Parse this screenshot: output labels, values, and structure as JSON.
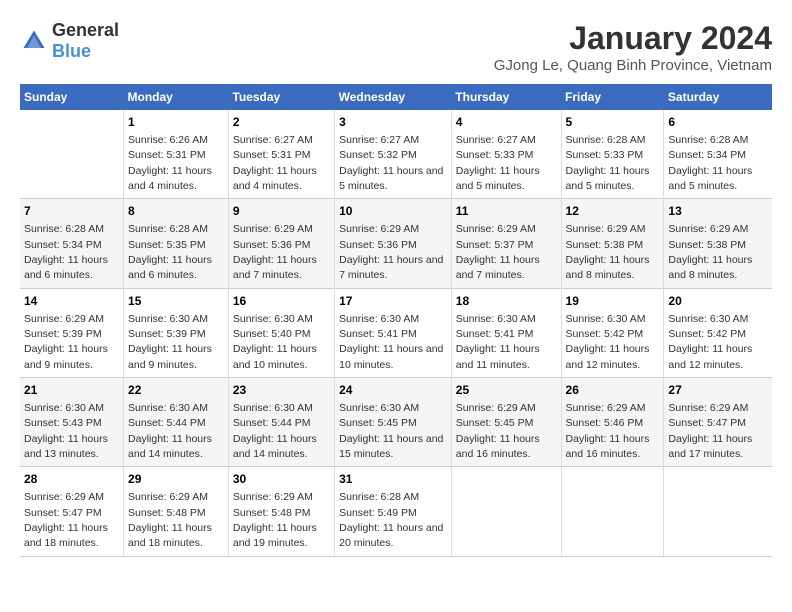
{
  "header": {
    "logo_general": "General",
    "logo_blue": "Blue",
    "title": "January 2024",
    "subtitle": "GJong Le, Quang Binh Province, Vietnam"
  },
  "days_of_week": [
    "Sunday",
    "Monday",
    "Tuesday",
    "Wednesday",
    "Thursday",
    "Friday",
    "Saturday"
  ],
  "weeks": [
    [
      {
        "day": "",
        "sunrise": "",
        "sunset": "",
        "daylight": ""
      },
      {
        "day": "1",
        "sunrise": "Sunrise: 6:26 AM",
        "sunset": "Sunset: 5:31 PM",
        "daylight": "Daylight: 11 hours and 4 minutes."
      },
      {
        "day": "2",
        "sunrise": "Sunrise: 6:27 AM",
        "sunset": "Sunset: 5:31 PM",
        "daylight": "Daylight: 11 hours and 4 minutes."
      },
      {
        "day": "3",
        "sunrise": "Sunrise: 6:27 AM",
        "sunset": "Sunset: 5:32 PM",
        "daylight": "Daylight: 11 hours and 5 minutes."
      },
      {
        "day": "4",
        "sunrise": "Sunrise: 6:27 AM",
        "sunset": "Sunset: 5:33 PM",
        "daylight": "Daylight: 11 hours and 5 minutes."
      },
      {
        "day": "5",
        "sunrise": "Sunrise: 6:28 AM",
        "sunset": "Sunset: 5:33 PM",
        "daylight": "Daylight: 11 hours and 5 minutes."
      },
      {
        "day": "6",
        "sunrise": "Sunrise: 6:28 AM",
        "sunset": "Sunset: 5:34 PM",
        "daylight": "Daylight: 11 hours and 5 minutes."
      }
    ],
    [
      {
        "day": "7",
        "sunrise": "Sunrise: 6:28 AM",
        "sunset": "Sunset: 5:34 PM",
        "daylight": "Daylight: 11 hours and 6 minutes."
      },
      {
        "day": "8",
        "sunrise": "Sunrise: 6:28 AM",
        "sunset": "Sunset: 5:35 PM",
        "daylight": "Daylight: 11 hours and 6 minutes."
      },
      {
        "day": "9",
        "sunrise": "Sunrise: 6:29 AM",
        "sunset": "Sunset: 5:36 PM",
        "daylight": "Daylight: 11 hours and 7 minutes."
      },
      {
        "day": "10",
        "sunrise": "Sunrise: 6:29 AM",
        "sunset": "Sunset: 5:36 PM",
        "daylight": "Daylight: 11 hours and 7 minutes."
      },
      {
        "day": "11",
        "sunrise": "Sunrise: 6:29 AM",
        "sunset": "Sunset: 5:37 PM",
        "daylight": "Daylight: 11 hours and 7 minutes."
      },
      {
        "day": "12",
        "sunrise": "Sunrise: 6:29 AM",
        "sunset": "Sunset: 5:38 PM",
        "daylight": "Daylight: 11 hours and 8 minutes."
      },
      {
        "day": "13",
        "sunrise": "Sunrise: 6:29 AM",
        "sunset": "Sunset: 5:38 PM",
        "daylight": "Daylight: 11 hours and 8 minutes."
      }
    ],
    [
      {
        "day": "14",
        "sunrise": "Sunrise: 6:29 AM",
        "sunset": "Sunset: 5:39 PM",
        "daylight": "Daylight: 11 hours and 9 minutes."
      },
      {
        "day": "15",
        "sunrise": "Sunrise: 6:30 AM",
        "sunset": "Sunset: 5:39 PM",
        "daylight": "Daylight: 11 hours and 9 minutes."
      },
      {
        "day": "16",
        "sunrise": "Sunrise: 6:30 AM",
        "sunset": "Sunset: 5:40 PM",
        "daylight": "Daylight: 11 hours and 10 minutes."
      },
      {
        "day": "17",
        "sunrise": "Sunrise: 6:30 AM",
        "sunset": "Sunset: 5:41 PM",
        "daylight": "Daylight: 11 hours and 10 minutes."
      },
      {
        "day": "18",
        "sunrise": "Sunrise: 6:30 AM",
        "sunset": "Sunset: 5:41 PM",
        "daylight": "Daylight: 11 hours and 11 minutes."
      },
      {
        "day": "19",
        "sunrise": "Sunrise: 6:30 AM",
        "sunset": "Sunset: 5:42 PM",
        "daylight": "Daylight: 11 hours and 12 minutes."
      },
      {
        "day": "20",
        "sunrise": "Sunrise: 6:30 AM",
        "sunset": "Sunset: 5:42 PM",
        "daylight": "Daylight: 11 hours and 12 minutes."
      }
    ],
    [
      {
        "day": "21",
        "sunrise": "Sunrise: 6:30 AM",
        "sunset": "Sunset: 5:43 PM",
        "daylight": "Daylight: 11 hours and 13 minutes."
      },
      {
        "day": "22",
        "sunrise": "Sunrise: 6:30 AM",
        "sunset": "Sunset: 5:44 PM",
        "daylight": "Daylight: 11 hours and 14 minutes."
      },
      {
        "day": "23",
        "sunrise": "Sunrise: 6:30 AM",
        "sunset": "Sunset: 5:44 PM",
        "daylight": "Daylight: 11 hours and 14 minutes."
      },
      {
        "day": "24",
        "sunrise": "Sunrise: 6:30 AM",
        "sunset": "Sunset: 5:45 PM",
        "daylight": "Daylight: 11 hours and 15 minutes."
      },
      {
        "day": "25",
        "sunrise": "Sunrise: 6:29 AM",
        "sunset": "Sunset: 5:45 PM",
        "daylight": "Daylight: 11 hours and 16 minutes."
      },
      {
        "day": "26",
        "sunrise": "Sunrise: 6:29 AM",
        "sunset": "Sunset: 5:46 PM",
        "daylight": "Daylight: 11 hours and 16 minutes."
      },
      {
        "day": "27",
        "sunrise": "Sunrise: 6:29 AM",
        "sunset": "Sunset: 5:47 PM",
        "daylight": "Daylight: 11 hours and 17 minutes."
      }
    ],
    [
      {
        "day": "28",
        "sunrise": "Sunrise: 6:29 AM",
        "sunset": "Sunset: 5:47 PM",
        "daylight": "Daylight: 11 hours and 18 minutes."
      },
      {
        "day": "29",
        "sunrise": "Sunrise: 6:29 AM",
        "sunset": "Sunset: 5:48 PM",
        "daylight": "Daylight: 11 hours and 18 minutes."
      },
      {
        "day": "30",
        "sunrise": "Sunrise: 6:29 AM",
        "sunset": "Sunset: 5:48 PM",
        "daylight": "Daylight: 11 hours and 19 minutes."
      },
      {
        "day": "31",
        "sunrise": "Sunrise: 6:28 AM",
        "sunset": "Sunset: 5:49 PM",
        "daylight": "Daylight: 11 hours and 20 minutes."
      },
      {
        "day": "",
        "sunrise": "",
        "sunset": "",
        "daylight": ""
      },
      {
        "day": "",
        "sunrise": "",
        "sunset": "",
        "daylight": ""
      },
      {
        "day": "",
        "sunrise": "",
        "sunset": "",
        "daylight": ""
      }
    ]
  ]
}
